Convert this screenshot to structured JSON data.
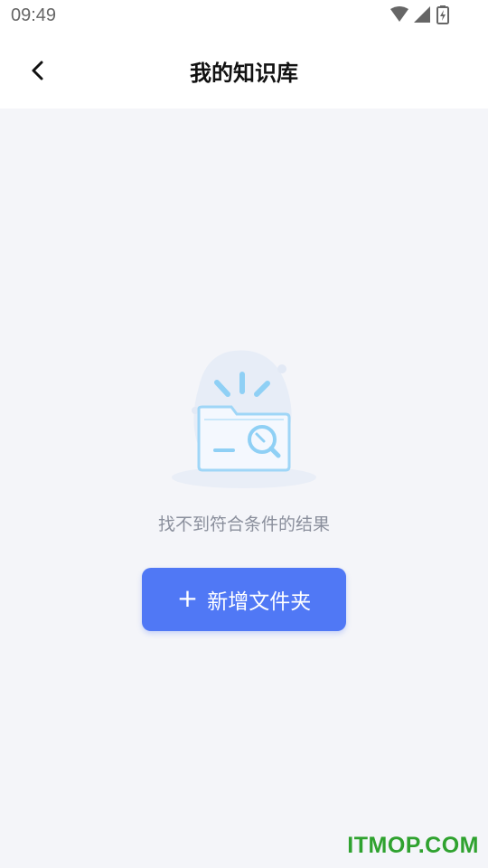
{
  "status_bar": {
    "time": "09:49",
    "icons": [
      "wifi-icon",
      "signal-icon",
      "battery-charging-icon"
    ]
  },
  "nav": {
    "back_icon": "chevron-left-icon",
    "title": "我的知识库"
  },
  "empty_state": {
    "illustration": "empty-folder-search-icon",
    "message": "找不到符合条件的结果",
    "button_label": "新增文件夹",
    "button_icon": "plus-icon"
  },
  "watermark": "ITMOP.COM",
  "colors": {
    "background": "#f4f5f9",
    "accent": "#5078f5",
    "empty_text": "#8a8f9c",
    "watermark": "#2fa22f"
  }
}
